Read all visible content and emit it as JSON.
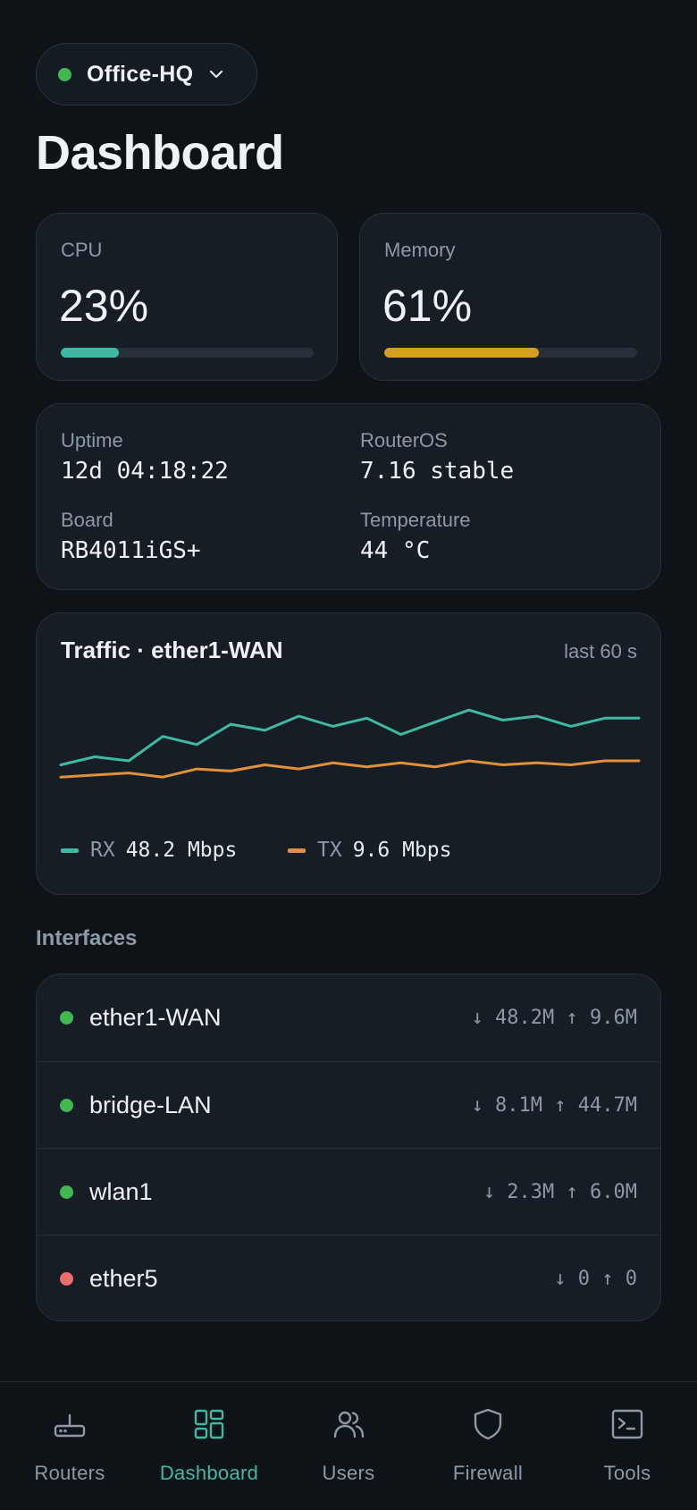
{
  "router": {
    "name": "Office-HQ",
    "status": "online",
    "status_color": "#3fb950"
  },
  "page": {
    "title": "Dashboard"
  },
  "stats": {
    "cpu": {
      "label": "CPU",
      "value": "23%",
      "fraction": 0.23,
      "color": "#3fb9a4"
    },
    "memory": {
      "label": "Memory",
      "value": "61%",
      "fraction": 0.61,
      "color": "#d6a01e"
    }
  },
  "info": {
    "uptime": {
      "label": "Uptime",
      "value": "12d 04:18:22"
    },
    "routeros": {
      "label": "RouterOS",
      "value": "7.16 stable"
    },
    "board": {
      "label": "Board",
      "value": "RB4011iGS+"
    },
    "temperature": {
      "label": "Temperature",
      "value": "44 °C"
    }
  },
  "traffic": {
    "title": "Traffic · ether1-WAN",
    "period": "last 60 s",
    "rx": {
      "name": "RX",
      "value": "48.2 Mbps",
      "color": "#3fb9a4"
    },
    "tx": {
      "name": "TX",
      "value": "9.6 Mbps",
      "color": "#e0913a"
    }
  },
  "chart_data": {
    "type": "line",
    "x": [
      0,
      1,
      2,
      3,
      4,
      5,
      6,
      7,
      8,
      9,
      10,
      11,
      12,
      13,
      14,
      15,
      16,
      17
    ],
    "series": [
      {
        "name": "RX",
        "color": "#3fb9a4",
        "values": [
          20,
          24,
          22,
          34,
          30,
          40,
          37,
          44,
          39,
          43,
          35,
          41,
          47,
          42,
          44,
          39,
          43,
          43
        ]
      },
      {
        "name": "TX",
        "color": "#e0913a",
        "values": [
          14,
          15,
          16,
          14,
          18,
          17,
          20,
          18,
          21,
          19,
          21,
          19,
          22,
          20,
          21,
          20,
          22,
          22
        ]
      }
    ],
    "ylim": [
      0,
      55
    ],
    "grid": false
  },
  "interfaces": {
    "title": "Interfaces",
    "items": [
      {
        "name": "ether1-WAN",
        "rate": "↓ 48.2M ↑ 9.6M",
        "status_color": "#3fb950"
      },
      {
        "name": "bridge-LAN",
        "rate": "↓ 8.1M ↑ 44.7M",
        "status_color": "#3fb950"
      },
      {
        "name": "wlan1",
        "rate": "↓ 2.3M ↑ 6.0M",
        "status_color": "#3fb950"
      },
      {
        "name": "ether5",
        "rate": "↓ 0 ↑ 0",
        "status_color": "#f06b6b"
      }
    ]
  },
  "nav": {
    "items": [
      {
        "label": "Routers",
        "icon": "router-icon"
      },
      {
        "label": "Dashboard",
        "icon": "dashboard-icon",
        "active": true
      },
      {
        "label": "Users",
        "icon": "users-icon"
      },
      {
        "label": "Firewall",
        "icon": "shield-icon"
      },
      {
        "label": "Tools",
        "icon": "terminal-icon"
      }
    ],
    "active_color": "#3fb9a4"
  }
}
